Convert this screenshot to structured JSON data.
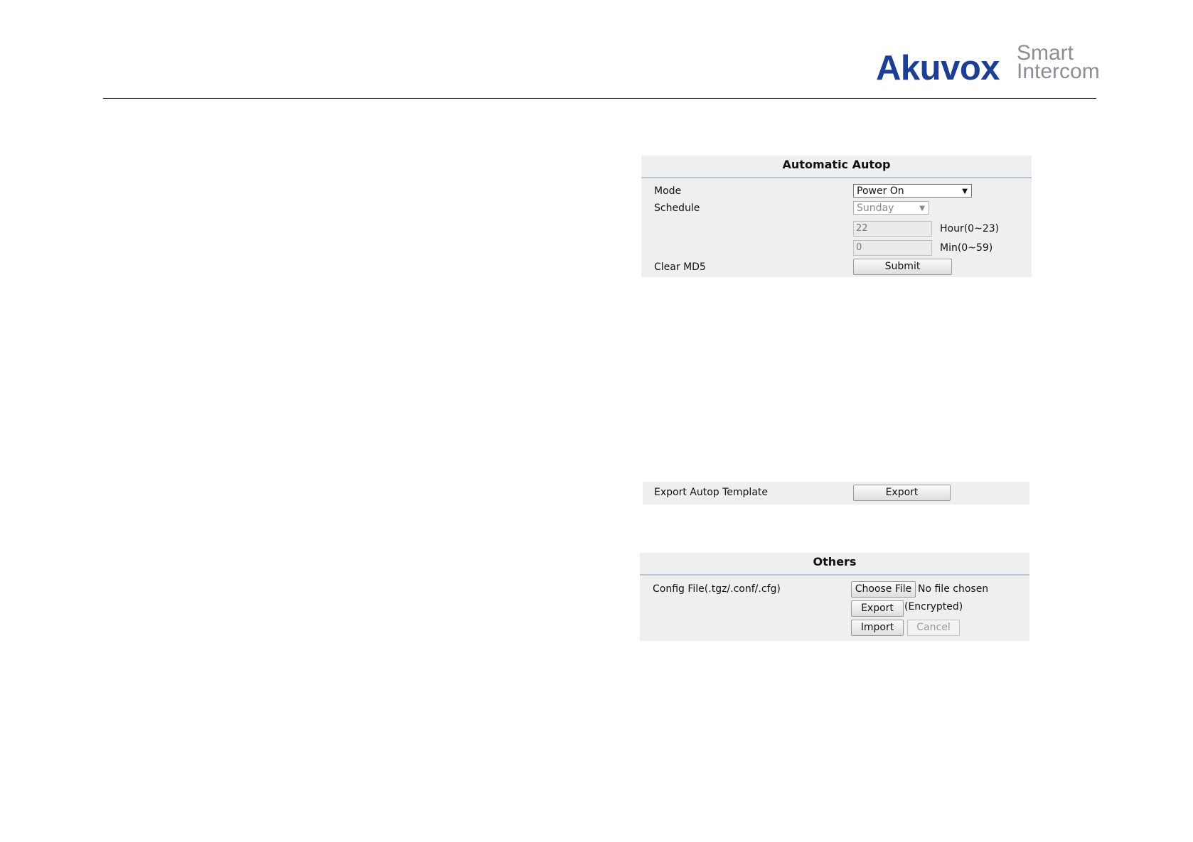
{
  "brand": {
    "name": "Akuvox",
    "tagline_line1": "Smart",
    "tagline_line2": "Intercom",
    "color": "#1c3f94"
  },
  "automatic_autop": {
    "title": "Automatic Autop",
    "mode_label": "Mode",
    "mode_value": "Power On",
    "schedule_label": "Schedule",
    "schedule_value": "Sunday",
    "hour_value": "22",
    "hour_hint": "Hour(0~23)",
    "min_value": "0",
    "min_hint": "Min(0~59)",
    "clear_md5_label": "Clear MD5",
    "submit_label": "Submit"
  },
  "export_template": {
    "label": "Export Autop Template",
    "export_label": "Export"
  },
  "others": {
    "title": "Others",
    "config_label": "Config File(.tgz/.conf/.cfg)",
    "choose_file_label": "Choose File",
    "no_file_text": "No file chosen",
    "export_label": "Export",
    "encrypted_text": "(Encrypted)",
    "import_label": "Import",
    "cancel_label": "Cancel"
  }
}
